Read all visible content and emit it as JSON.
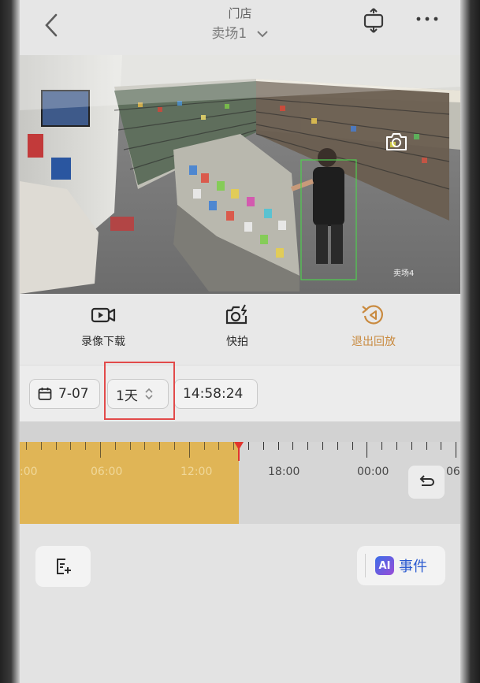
{
  "header": {
    "title": "门店",
    "subtitle": "卖场1"
  },
  "video": {
    "camera_label": "卖场4"
  },
  "actions": [
    {
      "label": "录像下载",
      "icon": "video-download-icon"
    },
    {
      "label": "快拍",
      "icon": "snapshot-icon"
    },
    {
      "label": "退出回放",
      "icon": "exit-playback-icon"
    }
  ],
  "controls": {
    "date": "7-07",
    "range": "1天",
    "time": "14:58:24"
  },
  "timeline": {
    "labels": [
      ":00",
      "06:00",
      "12:00",
      "18:00",
      "00:00",
      "06"
    ],
    "recorded_fraction": 0.5
  },
  "bottom": {
    "ai_badge": "AI",
    "ai_label": "事件"
  },
  "colors": {
    "accent": "#c98a3f",
    "record_band": "#e0b556",
    "playhead": "#e2342c",
    "highlight_box": "#e24a4a",
    "ai_label": "#2a5ad0"
  }
}
